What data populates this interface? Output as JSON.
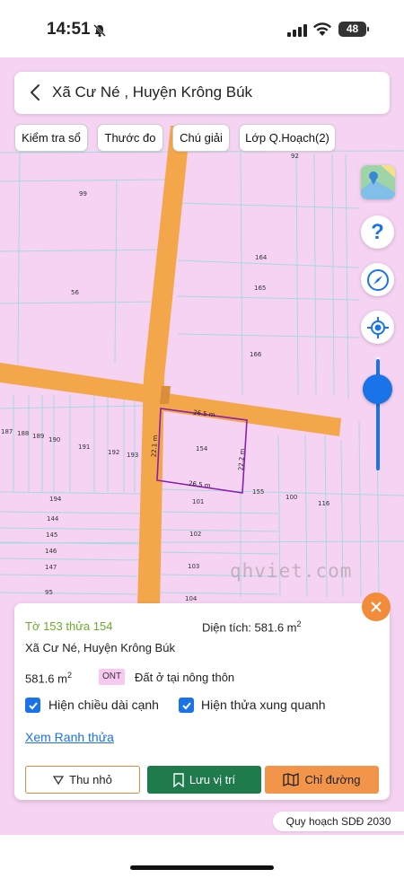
{
  "status": {
    "time": "14:51",
    "battery": "48"
  },
  "search": {
    "title": "Xã Cư Né , Huyện Krông Búk"
  },
  "chips": [
    {
      "label": "Kiểm tra sổ"
    },
    {
      "label": "Thước đo"
    },
    {
      "label": "Chú giải"
    },
    {
      "label": "Lớp Q.Hoạch(2)"
    }
  ],
  "map": {
    "parcel_numbers": [
      "92",
      "99",
      "56",
      "164",
      "165",
      "166",
      "187",
      "188",
      "189",
      "190",
      "191",
      "192",
      "193",
      "154",
      "155",
      "100",
      "116",
      "194",
      "101",
      "144",
      "145",
      "102",
      "146",
      "147",
      "103",
      "95",
      "104"
    ],
    "edges": {
      "top": "26.5 m",
      "bottom": "26.5 m",
      "left": "22.1 m",
      "right": "22.2 m"
    },
    "watermark": "qhviet.com"
  },
  "panel": {
    "sheet_parcel": "Tờ 153 thửa 154",
    "area_label": "Diện tích: 581.6 m",
    "area_sup": "2",
    "location": "Xã Cư Né, Huyện Krông Búk",
    "area_value": "581.6 m",
    "land_code": "ONT",
    "land_type": "Đất ở tại nông thôn",
    "check_edge_length": "Hiện chiều dài cạnh",
    "check_neighbors": "Hiện thửa xung quanh",
    "boundary_link": "Xem Ranh thửa",
    "buttons": {
      "shrink": "Thu nhỏ",
      "save": "Lưu vị trí",
      "route": "Chỉ đường"
    }
  },
  "legend": "Quy hoạch SDĐ 2030",
  "colors": {
    "map_bg": "#f6d3f3",
    "road": "#f4a64a",
    "parcel_line": "#a8d8e0",
    "selected": "#8a1fb0",
    "accent": "#1a73e8",
    "save": "#1f7a4c",
    "route": "#f2954a"
  }
}
